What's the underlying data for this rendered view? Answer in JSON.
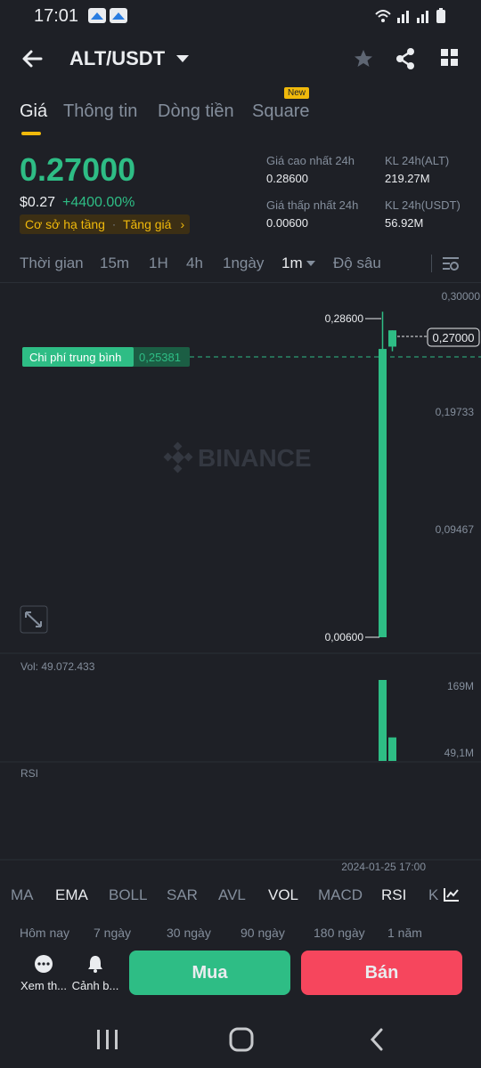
{
  "status_bar": {
    "time": "17:01"
  },
  "header": {
    "pair": "ALT/USDT"
  },
  "tabs": [
    {
      "label": "Giá"
    },
    {
      "label": "Thông tin"
    },
    {
      "label": "Dòng tiền"
    },
    {
      "label": "Square"
    }
  ],
  "new_badge": "New",
  "price": {
    "last": "0.27000",
    "usd": "$0.27",
    "change": "+4400.00%",
    "tags": [
      "Cơ sở hạ tầng",
      "Tăng giá"
    ]
  },
  "stats": {
    "high_label": "Giá cao nhất 24h",
    "high_value": "0.28600",
    "vol_alt_label": "KL 24h(ALT)",
    "vol_alt_value": "219.27M",
    "low_label": "Giá thấp nhất 24h",
    "low_value": "0.00600",
    "vol_usdt_label": "KL 24h(USDT)",
    "vol_usdt_value": "56.92M"
  },
  "intervals": {
    "items": [
      "Thời gian",
      "15m",
      "1H",
      "4h",
      "1ngày",
      "1m",
      "Độ sâu"
    ],
    "selected": "1m"
  },
  "chart": {
    "axis_labels": [
      "0,30000",
      "0,19733",
      "0,09467"
    ],
    "high_marker": "0,28600",
    "low_marker": "0,00600",
    "current_price": "0,27000",
    "avg_cost_label": "Chi phí trung bình",
    "avg_cost_value": "0,25381",
    "watermark": "BINANCE",
    "vol_label": "Vol: 49.072.433",
    "vol_axis": [
      "169M",
      "49,1M"
    ],
    "rsi_label": "RSI",
    "timestamp": "2024-01-25 17:00",
    "colors": {
      "up": "#2ebd85",
      "down": "#f6465d",
      "accent": "#f0b90b"
    }
  },
  "chart_data": {
    "type": "candlestick",
    "price_axis_ticks": [
      0.3,
      0.19733,
      0.09467
    ],
    "candles": [
      {
        "open": 0.006,
        "high": 0.286,
        "low": 0.006,
        "close": 0.254
      },
      {
        "open": 0.256,
        "high": 0.27,
        "low": 0.252,
        "close": 0.27
      }
    ],
    "volume": [
      169000000,
      49100000
    ],
    "volume_axis_ticks": [
      "169M",
      "49,1M"
    ],
    "average_cost": 0.25381,
    "last_price": 0.27,
    "time_label": "2024-01-25 17:00"
  },
  "indicators": {
    "items": [
      "MA",
      "EMA",
      "BOLL",
      "SAR",
      "AVL",
      "VOL",
      "MACD",
      "RSI",
      "K"
    ],
    "active": [
      "EMA",
      "VOL",
      "RSI"
    ]
  },
  "ranges": [
    "Hôm nay",
    "7 ngày",
    "30 ngày",
    "90 ngày",
    "180 ngày",
    "1 năm"
  ],
  "bottom_actions": {
    "more_label": "Xem th...",
    "alert_label": "Cảnh b...",
    "buy_label": "Mua",
    "sell_label": "Bán"
  }
}
